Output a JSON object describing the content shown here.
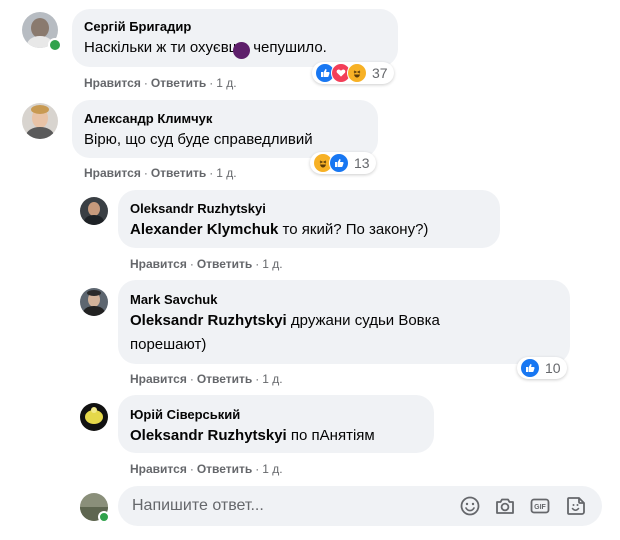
{
  "comments": [
    {
      "author": "Сергій Бригадир",
      "text": "Наскільки ж ти охуєвше чепушило.",
      "reactions_count": "37",
      "actions": {
        "like": "Нравится",
        "reply": "Ответить",
        "time": "1 д."
      }
    },
    {
      "author": "Александр Климчук",
      "text": "Вірю, що суд буде справедливий",
      "reactions_count": "13",
      "actions": {
        "like": "Нравится",
        "reply": "Ответить",
        "time": "1 д."
      }
    }
  ],
  "replies": [
    {
      "author": "Oleksandr Ruzhytskyi",
      "mention": "Alexander Klymchuk",
      "text": " то який? По закону?)",
      "actions": {
        "like": "Нравится",
        "reply": "Ответить",
        "time": "1 д."
      }
    },
    {
      "author": "Mark Savchuk",
      "mention": "Oleksandr Ruzhytskyi",
      "text_line1": " дружани судьи Вовка",
      "text_line2": "порешают)",
      "reactions_count": "10",
      "actions": {
        "like": "Нравится",
        "reply": "Ответить",
        "time": "1 д."
      }
    },
    {
      "author": "Юрій Сіверський",
      "mention": "Oleksandr Ruzhytskyi",
      "text": " по пАнятіям",
      "actions": {
        "like": "Нравится",
        "reply": "Ответить",
        "time": "1 д."
      }
    }
  ],
  "reply_box": {
    "placeholder": "Напишите ответ..."
  },
  "colors": {
    "bubble": "#f0f2f5",
    "meta_text": "#65676b",
    "like_blue": "#1877f2",
    "love_red": "#f33e58",
    "haha_yellow": "#f7b125",
    "online_green": "#31a24c"
  }
}
